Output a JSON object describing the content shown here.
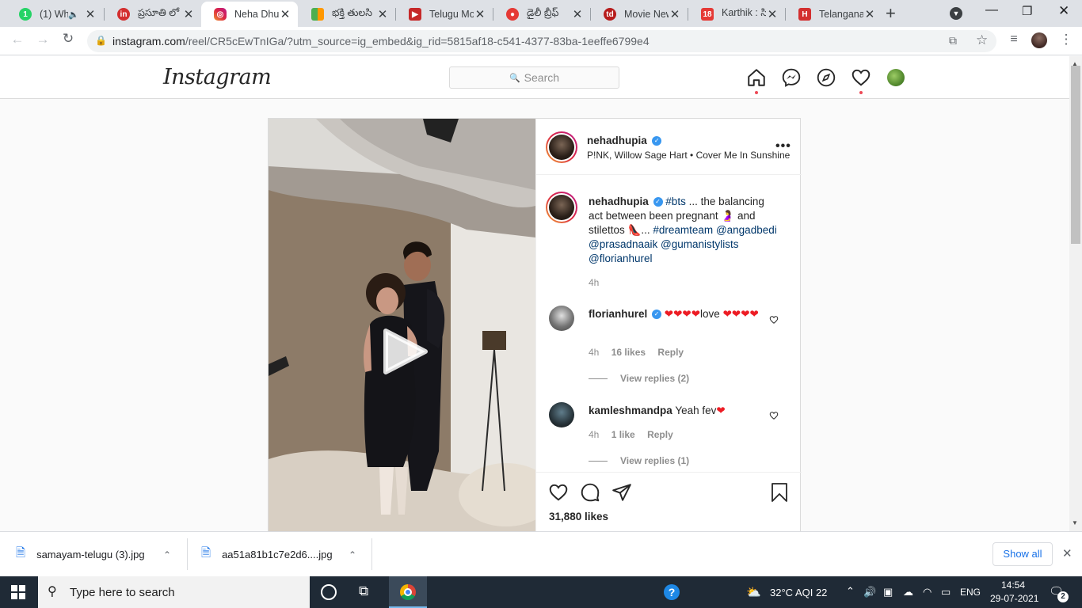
{
  "browser": {
    "tabs": [
      {
        "label": "(1) Wh",
        "fav_color": "#25d366",
        "fav_text": "1"
      },
      {
        "label": "ప్రసూతి లో",
        "fav_color": "#d32f2f",
        "fav_text": "in"
      },
      {
        "label": "Neha Dhup",
        "fav_color": "#c13584",
        "fav_text": ""
      },
      {
        "label": "భక్తి తులసి",
        "fav_color": "#4caf50",
        "fav_text": ""
      },
      {
        "label": "Telugu Mo",
        "fav_color": "#c62828",
        "fav_text": "▶"
      },
      {
        "label": "డైలీ బ్రీఫ్",
        "fav_color": "#e53935",
        "fav_text": "●"
      },
      {
        "label": "Movie New",
        "fav_color": "#b71c1c",
        "fav_text": "td"
      },
      {
        "label": "Karthik : సి",
        "fav_color": "#e53935",
        "fav_text": "18"
      },
      {
        "label": "Telangana",
        "fav_color": "#d32f2f",
        "fav_text": "H"
      }
    ],
    "url_host": "instagram.com",
    "url_rest": "/reel/CR5cEwTnIGa/?utm_source=ig_embed&ig_rid=5815af18-c541-4377-83ba-1eeffe6799e4"
  },
  "ig": {
    "logo": "Instagram",
    "search_placeholder": "Search",
    "post": {
      "owner": "nehadhupia",
      "audio": "P!NK, Willow Sage Hart • Cover Me In Sunshine",
      "caption_user": "nehadhupia",
      "caption_tag1": "#bts",
      "caption_text1": "... the balancing act between been pregnant",
      "caption_text2": "and stilettos",
      "caption_ellipsis": "...",
      "caption_tag2": "#dreamteam",
      "mention1": "@angadbedi",
      "mention2": "@prasadnaaik",
      "mention3": "@gumanistylists",
      "mention4": "@florianhurel",
      "caption_time": "4h",
      "comments": [
        {
          "user": "florianhurel",
          "text": "love",
          "time": "4h",
          "likes": "16 likes",
          "reply": "Reply",
          "view_replies": "View replies (2)"
        },
        {
          "user": "kamleshmandpa",
          "text": "Yeah fev",
          "time": "4h",
          "likes": "1 like",
          "reply": "Reply",
          "view_replies": "View replies (1)"
        }
      ],
      "likes": "31,880 likes"
    }
  },
  "downloads": {
    "items": [
      "samayam-telugu (3).jpg",
      "aa51a81b1c7e2d6....jpg"
    ],
    "show_all": "Show all"
  },
  "taskbar": {
    "search_placeholder": "Type here to search",
    "weather": "32°C  AQI 22",
    "lang": "ENG",
    "time": "14:54",
    "date": "29-07-2021",
    "notif_count": "2"
  }
}
